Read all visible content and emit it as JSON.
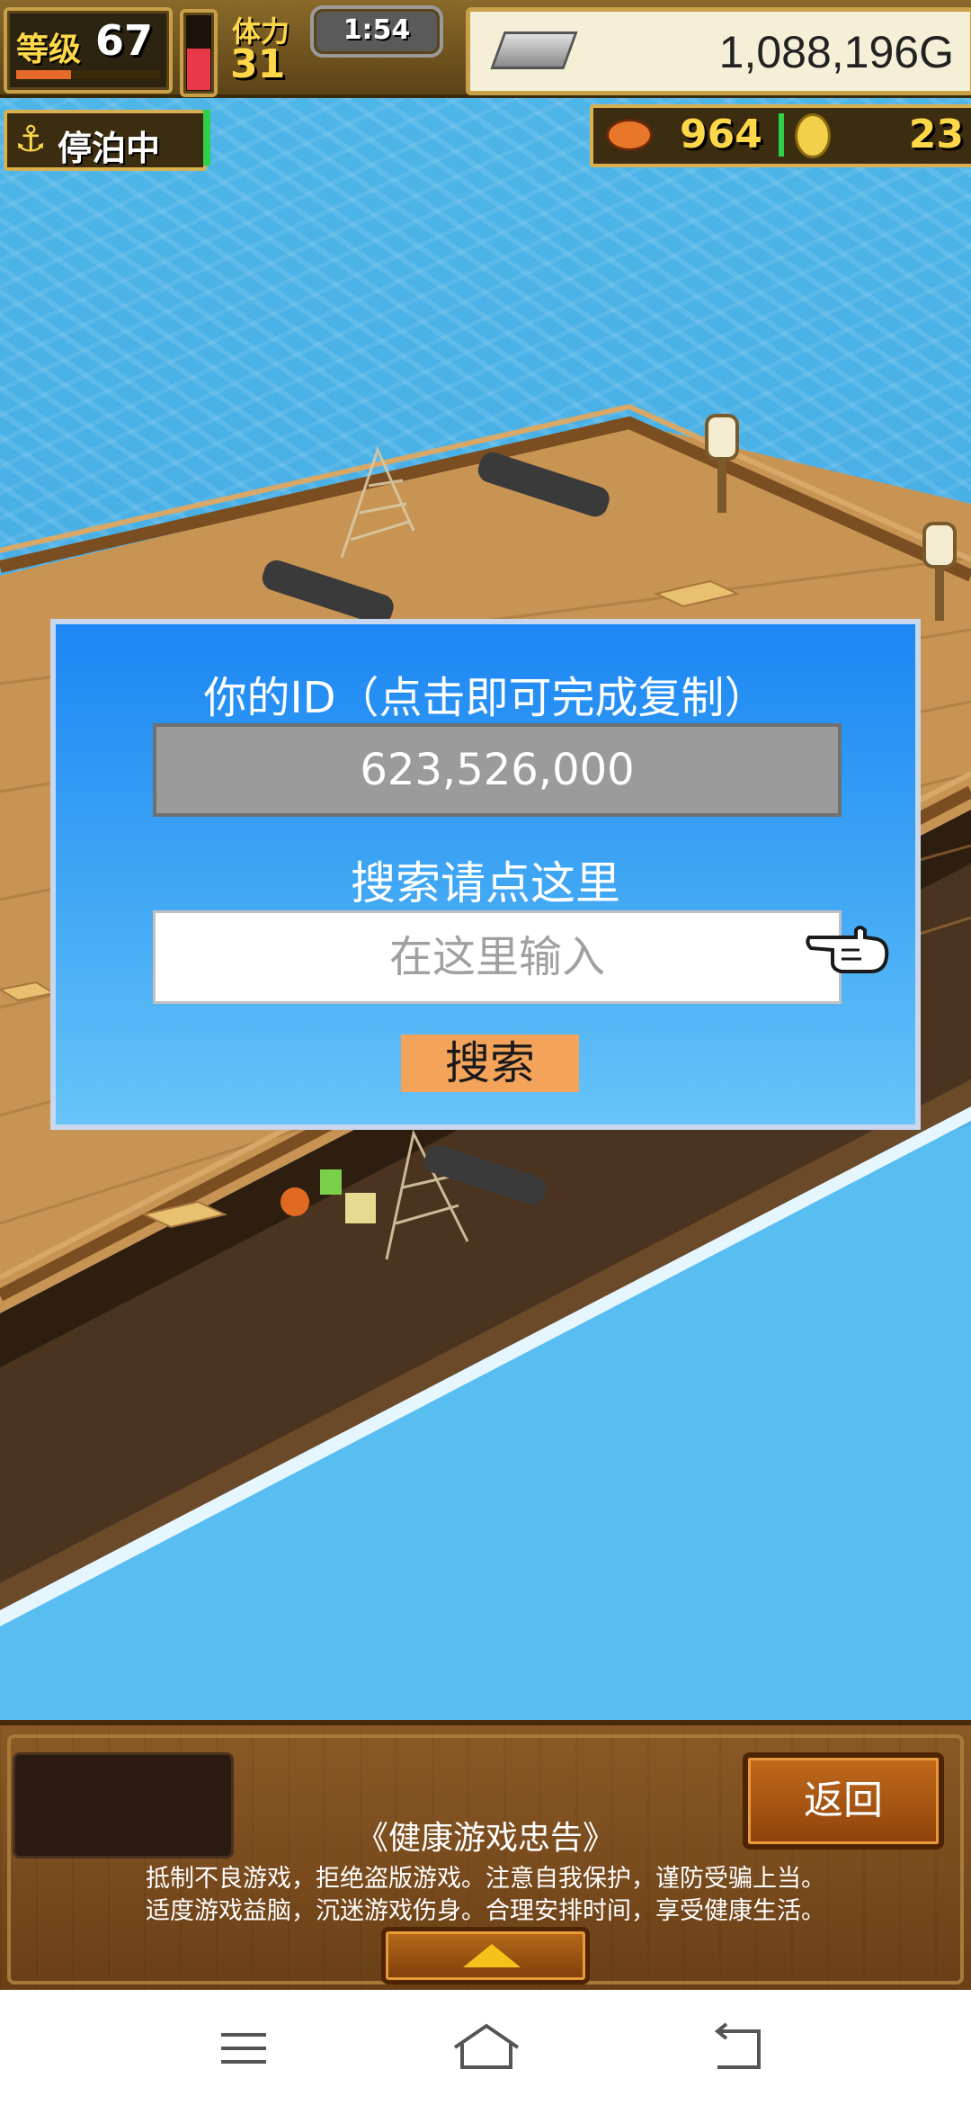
{
  "hud": {
    "level_label": "等级",
    "level_value": "67",
    "stamina_label": "体力",
    "stamina_value": "31",
    "time": "1:54",
    "money": "1,088,196G",
    "status": "停泊中",
    "food": "964",
    "coins": "23"
  },
  "dialog": {
    "title": "你的ID（点击即可完成复制）",
    "id_value": "623,526,000",
    "search_label": "搜索请点这里",
    "search_placeholder": "在这里输入",
    "search_button": "搜索"
  },
  "bottom": {
    "back_button": "返回",
    "notice_title": "《健康游戏忠告》",
    "notice_line1": "抵制不良游戏，拒绝盗版游戏。注意自我保护，谨防受骗上当。",
    "notice_line2": "适度游戏益脑，沉迷游戏伤身。合理安排时间，享受健康生活。"
  },
  "colors": {
    "dialog_top": "#1c86f4",
    "dialog_bottom": "#66c4f8",
    "id_field": "#9b9b9b",
    "search_button": "#f4a45a",
    "back_button": "#a8560f",
    "sea": "#47aee6"
  },
  "icons": {
    "money": "silver-bar-icon",
    "status": "anchor-icon",
    "food": "food-icon",
    "coin": "gold-coin-icon",
    "pointer": "pointing-hand-icon",
    "expand": "triangle-up-icon",
    "nav_menu": "menu-icon",
    "nav_home": "home-icon",
    "nav_back": "back-icon"
  }
}
